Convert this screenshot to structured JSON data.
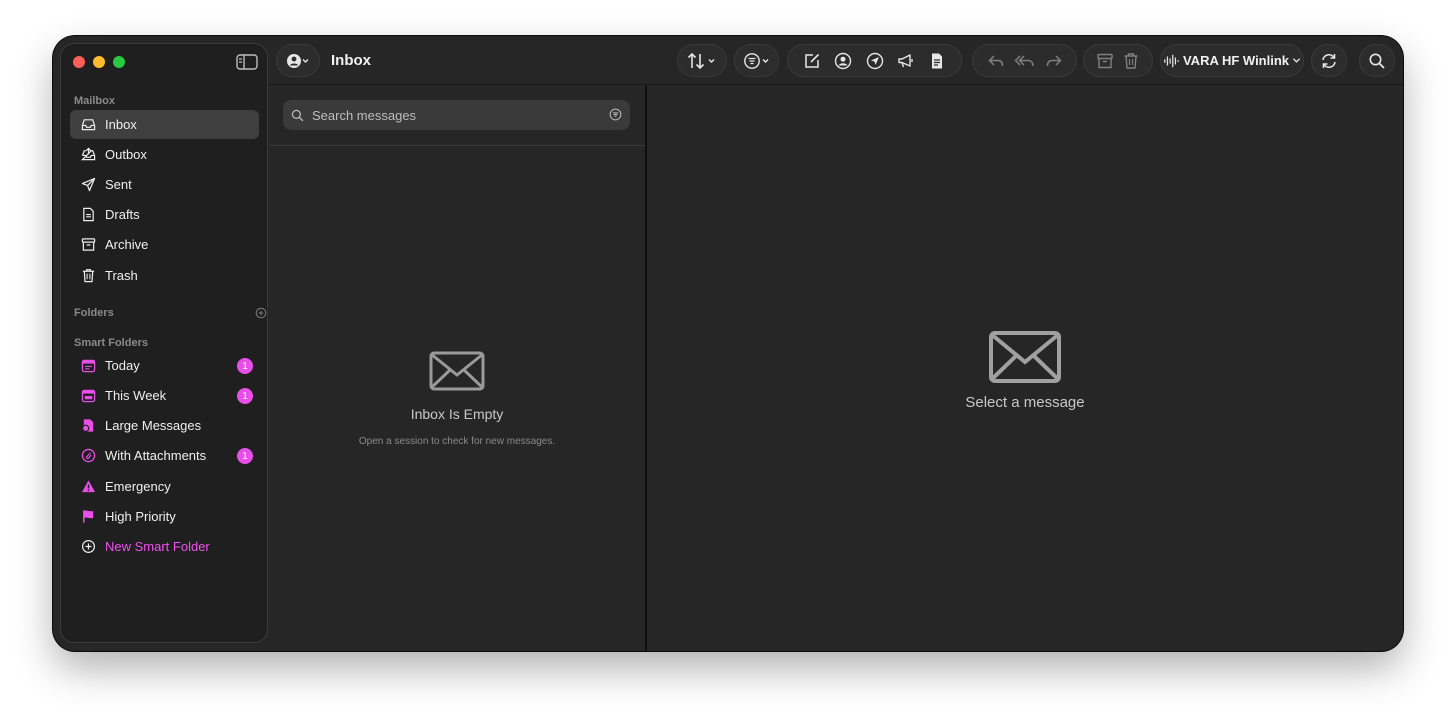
{
  "toolbar": {
    "title": "Inbox",
    "connection_label": "VARA HF Winlink"
  },
  "sidebar": {
    "mailbox_label": "Mailbox",
    "mailbox_items": [
      {
        "label": "Inbox",
        "icon": "inbox-icon"
      },
      {
        "label": "Outbox",
        "icon": "outbox-icon"
      },
      {
        "label": "Sent",
        "icon": "paperplane-icon"
      },
      {
        "label": "Drafts",
        "icon": "document-icon"
      },
      {
        "label": "Archive",
        "icon": "archive-icon"
      },
      {
        "label": "Trash",
        "icon": "trash-icon"
      }
    ],
    "folders_label": "Folders",
    "smart_folders_label": "Smart Folders",
    "smart_items": [
      {
        "label": "Today",
        "icon": "calendar-icon",
        "badge": "1"
      },
      {
        "label": "This Week",
        "icon": "calendar-week-icon",
        "badge": "1"
      },
      {
        "label": "Large Messages",
        "icon": "large-doc-icon"
      },
      {
        "label": "With Attachments",
        "icon": "paperclip-icon",
        "badge": "1"
      },
      {
        "label": "Emergency",
        "icon": "warning-icon"
      },
      {
        "label": "High Priority",
        "icon": "flag-icon"
      }
    ],
    "new_smart_folder_label": "New Smart Folder"
  },
  "list": {
    "search_placeholder": "Search messages",
    "empty_title": "Inbox Is Empty",
    "empty_subtitle": "Open a session to check for new messages."
  },
  "detail": {
    "empty_text": "Select a message"
  },
  "colors": {
    "accent": "#e84fe8",
    "window_bg": "#262626",
    "sidebar_bg": "#1f1f1f"
  }
}
